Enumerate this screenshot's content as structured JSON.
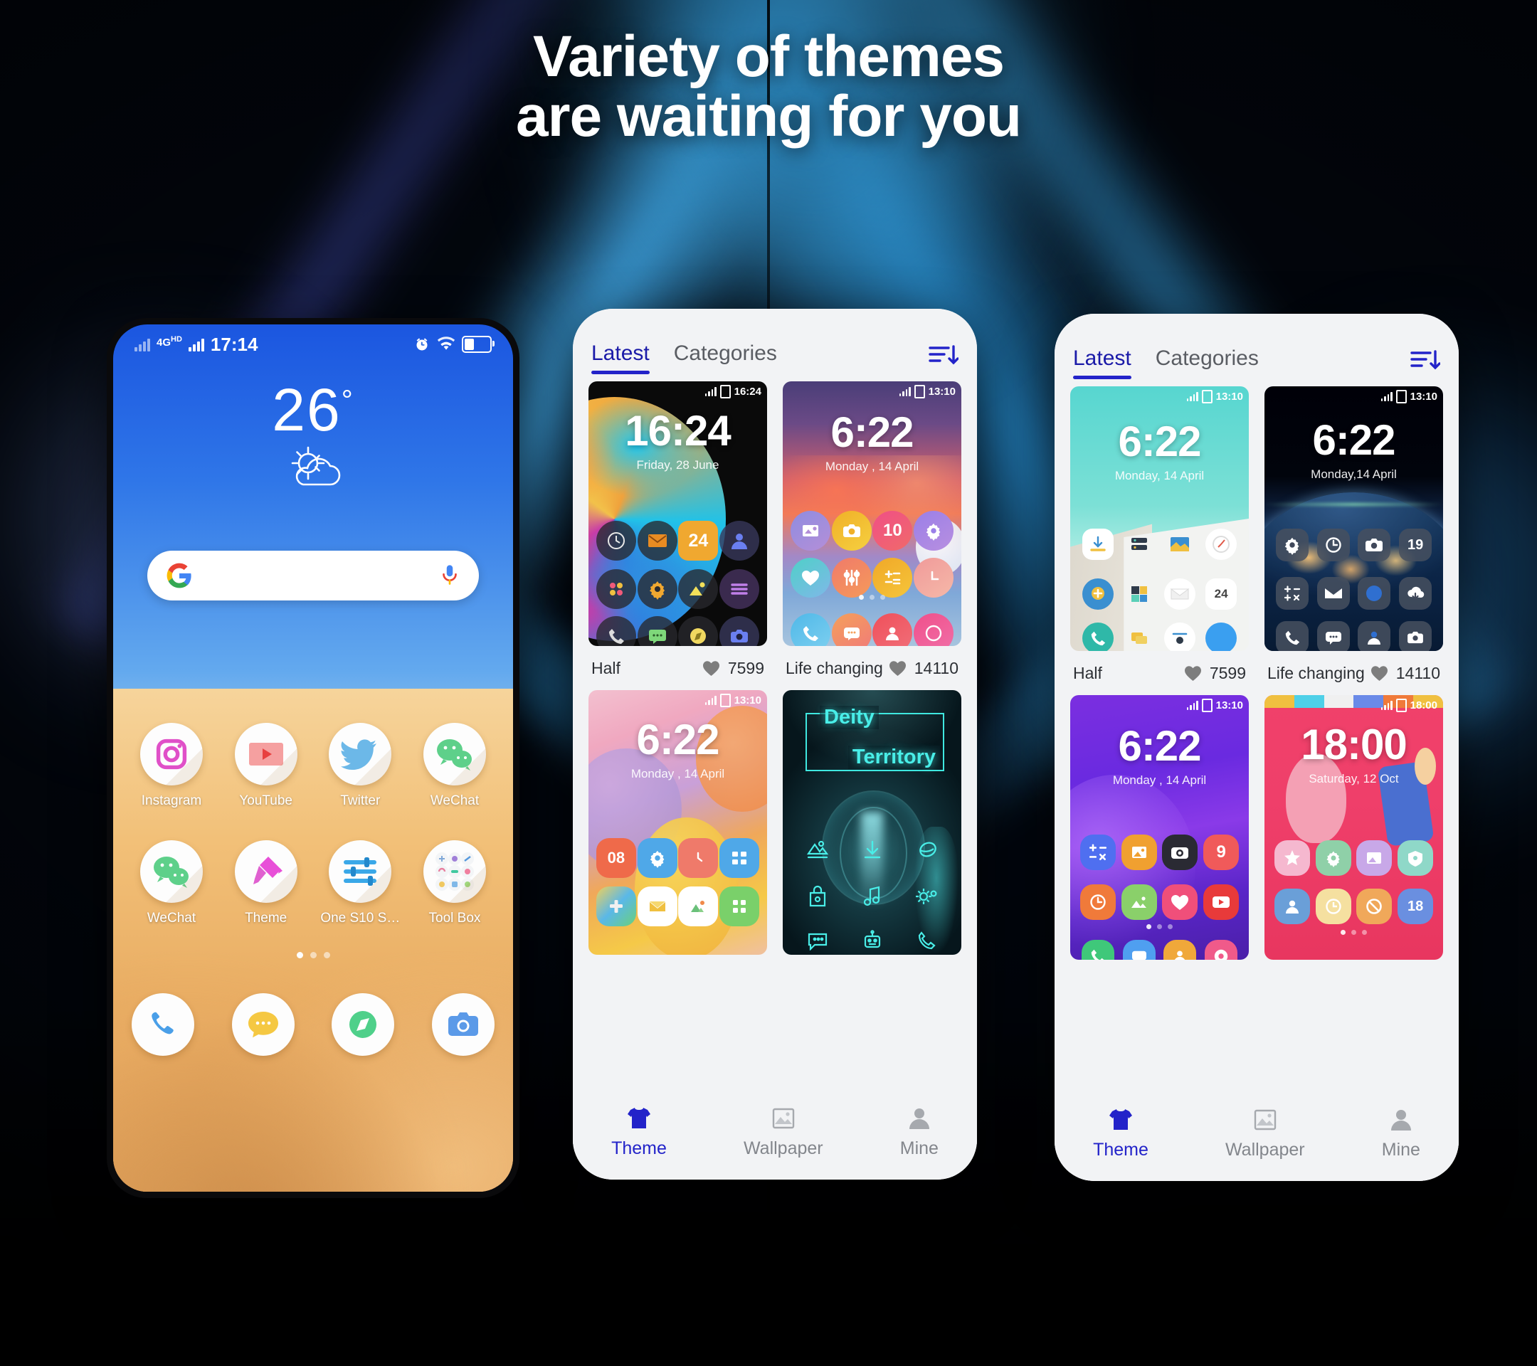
{
  "headline": {
    "line1": "Variety of themes",
    "line2": "are waiting for you"
  },
  "colors": {
    "accent": "#2323c9",
    "headline_text": "#ffffff",
    "store_bg": "#f2f3f5",
    "nav_inactive": "#83868c",
    "background": "#02060d"
  },
  "home_phone": {
    "status_bar": {
      "network_label": "4G",
      "network_hd": "HD",
      "time": "17:14",
      "icons": [
        "signal-icon",
        "alarm-icon",
        "wifi-icon",
        "battery-icon"
      ]
    },
    "weather": {
      "temperature": "26",
      "degree_symbol": "°",
      "icon": "sun-behind-cloud-icon"
    },
    "search": {
      "placeholder": "",
      "left_icon": "google-g-icon",
      "right_icon": "microphone-icon"
    },
    "app_rows": [
      [
        {
          "label": "Instagram",
          "icon": "instagram-icon"
        },
        {
          "label": "YouTube",
          "icon": "youtube-icon"
        },
        {
          "label": "Twitter",
          "icon": "twitter-icon"
        },
        {
          "label": "WeChat",
          "icon": "wechat-icon"
        }
      ],
      [
        {
          "label": "WeChat",
          "icon": "wechat-icon"
        },
        {
          "label": "Theme",
          "icon": "theme-brush-icon"
        },
        {
          "label": "One S10 Setti..",
          "icon": "settings-sliders-icon"
        },
        {
          "label": "Tool Box",
          "icon": "toolbox-grid-icon"
        }
      ]
    ],
    "page_dots": {
      "count": 3,
      "active_index": 0
    },
    "dock": [
      {
        "icon": "phone-icon",
        "label": "Phone"
      },
      {
        "icon": "messages-icon",
        "label": "Messages"
      },
      {
        "icon": "browser-icon",
        "label": "Browser"
      },
      {
        "icon": "camera-icon",
        "label": "Camera"
      }
    ]
  },
  "theme_store": {
    "tabs": [
      {
        "label": "Latest",
        "active": true
      },
      {
        "label": "Categories",
        "active": false
      }
    ],
    "sort_icon": "sort-descending-icon",
    "cards": [
      {
        "name": "Half",
        "likes": "7599",
        "like_icon": "heart-icon",
        "preview": {
          "variant": "planet",
          "status_time": "16:24",
          "clock": "16:24",
          "date": "Friday, 28 June"
        }
      },
      {
        "name": "Life changing",
        "likes": "14110",
        "like_icon": "heart-icon",
        "preview": {
          "variant": "sunset",
          "status_time": "13:10",
          "clock": "6:22",
          "date": "Monday , 14 April"
        }
      },
      {
        "name": "",
        "likes": "",
        "like_icon": "heart-icon",
        "preview": {
          "variant": "bubbles",
          "status_time": "13:10",
          "clock": "6:22",
          "date": "Monday , 14 April"
        }
      },
      {
        "name": "",
        "likes": "",
        "like_icon": "heart-icon",
        "preview": {
          "variant": "deity",
          "status_time": "",
          "clock": "",
          "date": "",
          "title_line1": "Deity",
          "title_line2": "Territory"
        }
      }
    ],
    "bottom_nav": [
      {
        "label": "Theme",
        "icon": "tshirt-icon",
        "active": true
      },
      {
        "label": "Wallpaper",
        "icon": "image-icon",
        "active": false
      },
      {
        "label": "Mine",
        "icon": "person-icon",
        "active": false
      }
    ]
  },
  "theme_store_2": {
    "tabs": [
      {
        "label": "Latest",
        "active": true
      },
      {
        "label": "Categories",
        "active": false
      }
    ],
    "sort_icon": "sort-descending-icon",
    "cards": [
      {
        "name": "Half",
        "likes": "7599",
        "like_icon": "heart-icon",
        "preview": {
          "variant": "mint",
          "status_time": "13:10",
          "clock": "6:22",
          "date": "Monday, 14 April"
        }
      },
      {
        "name": "Life changing",
        "likes": "14110",
        "like_icon": "heart-icon",
        "preview": {
          "variant": "earthnight",
          "status_time": "13:10",
          "clock": "6:22",
          "date": "Monday,14 April"
        }
      },
      {
        "name": "",
        "likes": "",
        "like_icon": "heart-icon",
        "preview": {
          "variant": "purple",
          "status_time": "13:10",
          "clock": "6:22",
          "date": "Monday , 14 April"
        }
      },
      {
        "name": "",
        "likes": "",
        "like_icon": "heart-icon",
        "preview": {
          "variant": "pink",
          "status_time": "18:00",
          "clock": "18:00",
          "date": "Saturday, 12 Oct"
        }
      }
    ],
    "bottom_nav": [
      {
        "label": "Theme",
        "icon": "tshirt-icon",
        "active": true
      },
      {
        "label": "Wallpaper",
        "icon": "image-icon",
        "active": false
      },
      {
        "label": "Mine",
        "icon": "person-icon",
        "active": false
      }
    ]
  }
}
